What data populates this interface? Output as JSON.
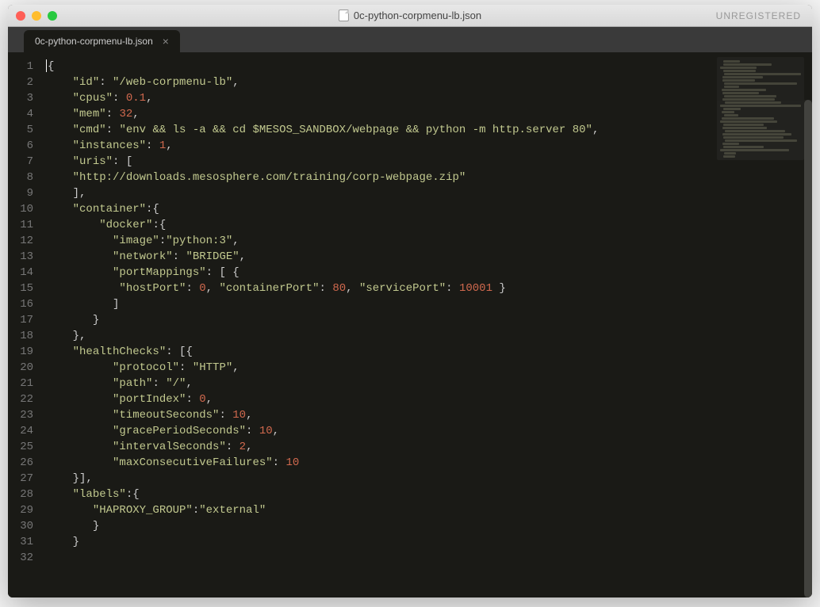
{
  "titlebar": {
    "filename": "0c-python-corpmenu-lb.json",
    "right_status": "UNREGISTERED"
  },
  "tab": {
    "label": "0c-python-corpmenu-lb.json",
    "close_glyph": "×"
  },
  "line_count": 32,
  "code_lines": [
    [
      [
        "punc",
        "{"
      ]
    ],
    [
      [
        "indent",
        "    "
      ],
      [
        "key",
        "\"id\""
      ],
      [
        "punc",
        ": "
      ],
      [
        "str",
        "\"/web-corpmenu-lb\""
      ],
      [
        "punc",
        ","
      ]
    ],
    [
      [
        "indent",
        "    "
      ],
      [
        "key",
        "\"cpus\""
      ],
      [
        "punc",
        ": "
      ],
      [
        "num",
        "0.1"
      ],
      [
        "punc",
        ","
      ]
    ],
    [
      [
        "indent",
        "    "
      ],
      [
        "key",
        "\"mem\""
      ],
      [
        "punc",
        ": "
      ],
      [
        "num",
        "32"
      ],
      [
        "punc",
        ","
      ]
    ],
    [
      [
        "indent",
        "    "
      ],
      [
        "key",
        "\"cmd\""
      ],
      [
        "punc",
        ": "
      ],
      [
        "str",
        "\"env && ls -a && cd $MESOS_SANDBOX/webpage && python -m http.server 80\""
      ],
      [
        "punc",
        ","
      ]
    ],
    [
      [
        "indent",
        "    "
      ],
      [
        "key",
        "\"instances\""
      ],
      [
        "punc",
        ": "
      ],
      [
        "num",
        "1"
      ],
      [
        "punc",
        ","
      ]
    ],
    [
      [
        "indent",
        "    "
      ],
      [
        "key",
        "\"uris\""
      ],
      [
        "punc",
        ": ["
      ]
    ],
    [
      [
        "indent",
        "    "
      ],
      [
        "str",
        "\"http://downloads.mesosphere.com/training/corp-webpage.zip\""
      ]
    ],
    [
      [
        "indent",
        "    "
      ],
      [
        "punc",
        "],"
      ]
    ],
    [
      [
        "indent",
        "    "
      ],
      [
        "key",
        "\"container\""
      ],
      [
        "punc",
        ":{"
      ]
    ],
    [
      [
        "indent",
        "        "
      ],
      [
        "key",
        "\"docker\""
      ],
      [
        "punc",
        ":{"
      ]
    ],
    [
      [
        "indent",
        "          "
      ],
      [
        "key",
        "\"image\""
      ],
      [
        "punc",
        ":"
      ],
      [
        "str",
        "\"python:3\""
      ],
      [
        "punc",
        ","
      ]
    ],
    [
      [
        "indent",
        "          "
      ],
      [
        "key",
        "\"network\""
      ],
      [
        "punc",
        ": "
      ],
      [
        "str",
        "\"BRIDGE\""
      ],
      [
        "punc",
        ","
      ]
    ],
    [
      [
        "indent",
        "          "
      ],
      [
        "key",
        "\"portMappings\""
      ],
      [
        "punc",
        ": [ {"
      ]
    ],
    [
      [
        "indent",
        "           "
      ],
      [
        "key",
        "\"hostPort\""
      ],
      [
        "punc",
        ": "
      ],
      [
        "num",
        "0"
      ],
      [
        "punc",
        ", "
      ],
      [
        "key",
        "\"containerPort\""
      ],
      [
        "punc",
        ": "
      ],
      [
        "num",
        "80"
      ],
      [
        "punc",
        ", "
      ],
      [
        "key",
        "\"servicePort\""
      ],
      [
        "punc",
        ": "
      ],
      [
        "num",
        "10001"
      ],
      [
        "punc",
        " }"
      ]
    ],
    [
      [
        "indent",
        "          "
      ],
      [
        "punc",
        "]"
      ]
    ],
    [
      [
        "indent",
        "       "
      ],
      [
        "punc",
        "}"
      ]
    ],
    [
      [
        "indent",
        "    "
      ],
      [
        "punc",
        "},"
      ]
    ],
    [
      [
        "indent",
        "    "
      ],
      [
        "key",
        "\"healthChecks\""
      ],
      [
        "punc",
        ": [{"
      ]
    ],
    [
      [
        "indent",
        "          "
      ],
      [
        "key",
        "\"protocol\""
      ],
      [
        "punc",
        ": "
      ],
      [
        "str",
        "\"HTTP\""
      ],
      [
        "punc",
        ","
      ]
    ],
    [
      [
        "indent",
        "          "
      ],
      [
        "key",
        "\"path\""
      ],
      [
        "punc",
        ": "
      ],
      [
        "str",
        "\"/\""
      ],
      [
        "punc",
        ","
      ]
    ],
    [
      [
        "indent",
        "          "
      ],
      [
        "key",
        "\"portIndex\""
      ],
      [
        "punc",
        ": "
      ],
      [
        "num",
        "0"
      ],
      [
        "punc",
        ","
      ]
    ],
    [
      [
        "indent",
        "          "
      ],
      [
        "key",
        "\"timeoutSeconds\""
      ],
      [
        "punc",
        ": "
      ],
      [
        "num",
        "10"
      ],
      [
        "punc",
        ","
      ]
    ],
    [
      [
        "indent",
        "          "
      ],
      [
        "key",
        "\"gracePeriodSeconds\""
      ],
      [
        "punc",
        ": "
      ],
      [
        "num",
        "10"
      ],
      [
        "punc",
        ","
      ]
    ],
    [
      [
        "indent",
        "          "
      ],
      [
        "key",
        "\"intervalSeconds\""
      ],
      [
        "punc",
        ": "
      ],
      [
        "num",
        "2"
      ],
      [
        "punc",
        ","
      ]
    ],
    [
      [
        "indent",
        "          "
      ],
      [
        "key",
        "\"maxConsecutiveFailures\""
      ],
      [
        "punc",
        ": "
      ],
      [
        "num",
        "10"
      ]
    ],
    [
      [
        "indent",
        "    "
      ],
      [
        "punc",
        "}],"
      ]
    ],
    [
      [
        "indent",
        "    "
      ],
      [
        "key",
        "\"labels\""
      ],
      [
        "punc",
        ":{"
      ]
    ],
    [
      [
        "indent",
        "       "
      ],
      [
        "key",
        "\"HAPROXY_GROUP\""
      ],
      [
        "punc",
        ":"
      ],
      [
        "str",
        "\"external\""
      ]
    ],
    [
      [
        "indent",
        "       "
      ],
      [
        "punc",
        "}"
      ]
    ],
    [
      [
        "indent",
        "    "
      ],
      [
        "punc",
        "}"
      ]
    ],
    [
      [
        "punc",
        ""
      ]
    ]
  ],
  "minimap_widths": [
    20,
    60,
    45,
    40,
    95,
    50,
    40,
    90,
    18,
    55,
    45,
    65,
    65,
    70,
    100,
    22,
    15,
    18,
    65,
    70,
    50,
    55,
    75,
    85,
    75,
    90,
    20,
    50,
    85,
    15,
    15
  ]
}
